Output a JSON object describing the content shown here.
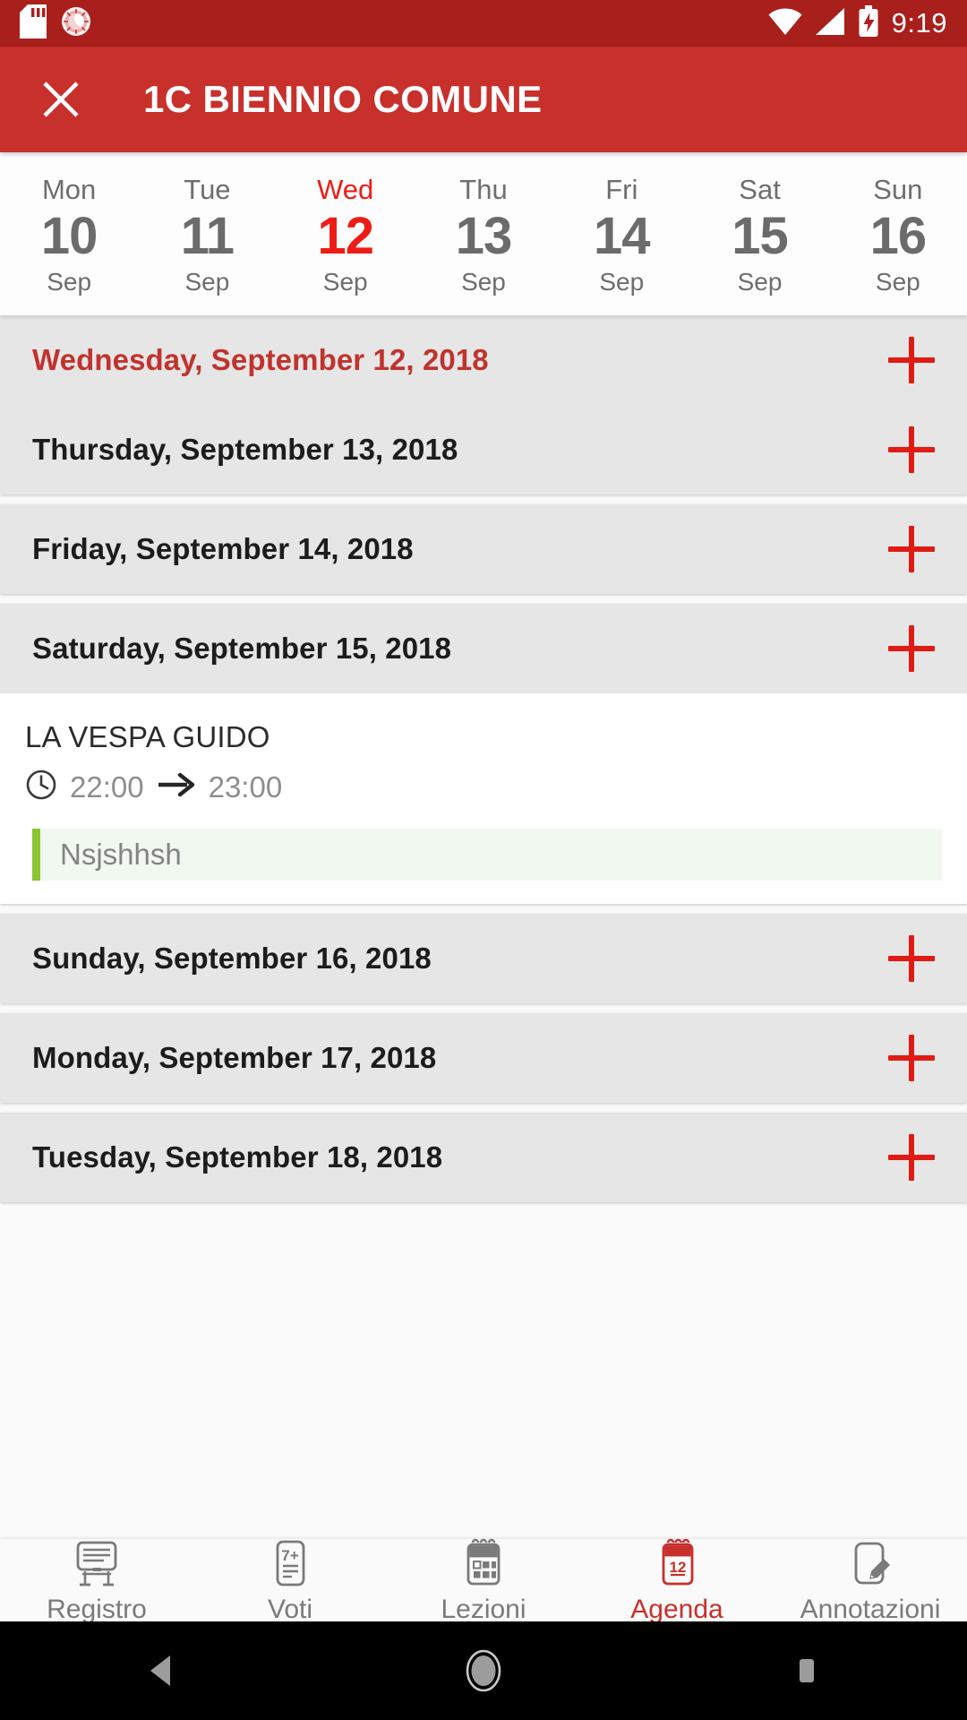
{
  "status_bar": {
    "time": "9:19",
    "icons": [
      "sd-card-icon",
      "alarm-icon",
      "wifi-icon",
      "signal-icon",
      "battery-charging-icon"
    ]
  },
  "app_bar": {
    "close_label": "close-icon",
    "title": "1C  BIENNIO COMUNE"
  },
  "week_strip": {
    "days": [
      {
        "dow": "Mon",
        "num": "10",
        "month": "Sep",
        "selected": false
      },
      {
        "dow": "Tue",
        "num": "11",
        "month": "Sep",
        "selected": false
      },
      {
        "dow": "Wed",
        "num": "12",
        "month": "Sep",
        "selected": true
      },
      {
        "dow": "Thu",
        "num": "13",
        "month": "Sep",
        "selected": false
      },
      {
        "dow": "Fri",
        "num": "14",
        "month": "Sep",
        "selected": false
      },
      {
        "dow": "Sat",
        "num": "15",
        "month": "Sep",
        "selected": false
      },
      {
        "dow": "Sun",
        "num": "16",
        "month": "Sep",
        "selected": false
      }
    ]
  },
  "agenda": {
    "add_icon": "plus-icon",
    "rows": [
      {
        "label": "Wednesday, September 12, 2018",
        "today": true
      },
      {
        "label": "Thursday, September 13, 2018",
        "today": false
      },
      {
        "label": "Friday, September 14, 2018",
        "today": false
      },
      {
        "label": "Saturday, September 15, 2018",
        "today": false
      },
      {
        "label": "Sunday, September 16, 2018",
        "today": false
      },
      {
        "label": "Monday, September 17, 2018",
        "today": false
      },
      {
        "label": "Tuesday, September 18, 2018",
        "today": false
      }
    ],
    "event": {
      "title": "LA VESPA GUIDO",
      "clock_icon": "clock-icon",
      "start_time": "22:00",
      "arrow_icon": "arrow-right-icon",
      "end_time": "23:00",
      "note": "Nsjshhsh",
      "note_accent": "#8bc533"
    }
  },
  "bottom_nav": {
    "items": [
      {
        "label": "Registro",
        "icon": "blackboard-icon",
        "active": false
      },
      {
        "label": "Voti",
        "icon": "grade-card-icon",
        "active": false
      },
      {
        "label": "Lezioni",
        "icon": "calendar-grid-icon",
        "active": false
      },
      {
        "label": "Agenda",
        "icon": "calendar-day-icon",
        "active": true
      },
      {
        "label": "Annotazioni",
        "icon": "note-pencil-icon",
        "active": false
      }
    ],
    "agenda_badge_day": "12"
  },
  "android_nav": {
    "back": "back-triangle-icon",
    "home": "home-circle-icon",
    "recents": "recents-square-icon"
  },
  "colors": {
    "status_bar": "#a91f1c",
    "app_bar": "#c8302c",
    "accent_red": "#e01b14",
    "today_red": "#c0332e",
    "row_bg": "#e6e6e6"
  }
}
